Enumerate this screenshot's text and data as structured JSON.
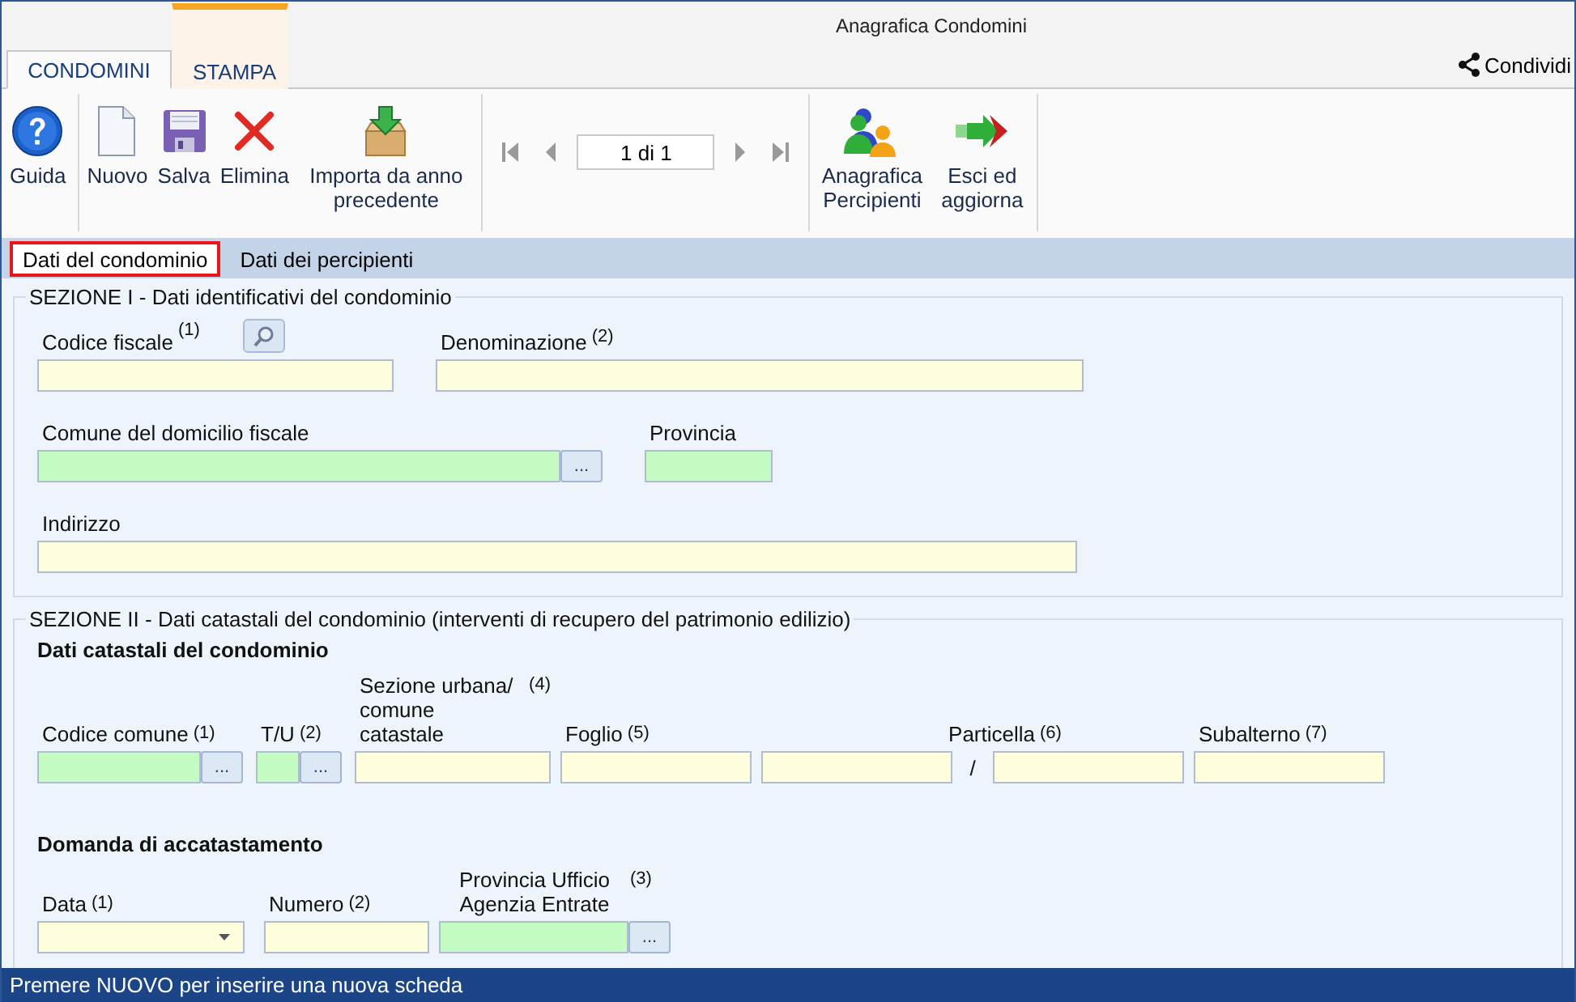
{
  "window": {
    "title": "Anagrafica Condomini"
  },
  "ribbon_tabs": [
    {
      "label": "CONDOMINI",
      "selected": true,
      "highlighted": false
    },
    {
      "label": "STAMPA",
      "selected": false,
      "highlighted": true
    }
  ],
  "share": {
    "label": "Condividi"
  },
  "toolbar": {
    "groups": [
      [
        {
          "label": "Guida"
        }
      ],
      [
        {
          "label": "Nuovo"
        },
        {
          "label": "Salva"
        },
        {
          "label": "Elimina"
        },
        {
          "label": "Importa da anno precedente"
        }
      ],
      [
        {
          "kind": "pager",
          "value": "1 di 1"
        }
      ],
      [
        {
          "label": "Anagrafica Percipienti"
        },
        {
          "label": "Esci ed aggiorna"
        }
      ]
    ]
  },
  "form_tabs": [
    {
      "label": "Dati del condominio",
      "selected": true
    },
    {
      "label": "Dati dei percipienti",
      "selected": false
    }
  ],
  "sections": [
    {
      "title": "SEZIONE I - Dati identificativi del condominio",
      "blocks": [
        {
          "fields": [
            {
              "label": "Codice fiscale",
              "note": "(1)",
              "kind": "search",
              "color": "#ffffdd"
            },
            {
              "label": "Denominazione",
              "note": "(2)",
              "kind": "text",
              "color": "#ffffdd"
            }
          ]
        },
        {
          "fields": [
            {
              "label": "Comune del domicilio fiscale",
              "kind": "lookup",
              "button": "...",
              "color": "#c4fcc4"
            },
            {
              "label": "Provincia",
              "kind": "text",
              "color": "#c4fcc4"
            }
          ]
        },
        {
          "fields": [
            {
              "label": "Indirizzo",
              "kind": "text",
              "color": "#ffffdd"
            }
          ]
        }
      ]
    },
    {
      "title": "SEZIONE II - Dati catastali del condominio (interventi di recupero del patrimonio edilizio)",
      "blocks": [
        {
          "heading": "Dati catastali del condominio",
          "fields": [
            {
              "label": "Codice comune",
              "note": "(1)",
              "kind": "lookup",
              "button": "...",
              "color": "#c4fcc4"
            },
            {
              "label": "T/U",
              "note": "(2)",
              "kind": "lookup",
              "button": "...",
              "color": "#c4fcc4"
            },
            {
              "label": "Sezione urbana/ comune catastale",
              "note": "(4)",
              "kind": "text",
              "color": "#ffffdd"
            },
            {
              "label": "Foglio",
              "note": "(5)",
              "kind": "text",
              "color": "#ffffdd"
            },
            {
              "label": "Particella",
              "note": "(6)",
              "kind": "split",
              "separator": "/",
              "color": "#ffffdd"
            },
            {
              "label": "Subalterno",
              "note": "(7)",
              "kind": "text",
              "color": "#ffffdd"
            }
          ]
        },
        {
          "heading": "Domanda di accatastamento",
          "fields": [
            {
              "label": "Data",
              "note": "(1)",
              "kind": "date",
              "color": "#ffffdd"
            },
            {
              "label": "Numero",
              "note": "(2)",
              "kind": "text",
              "color": "#ffffdd"
            },
            {
              "label": "Provincia Ufficio Agenzia Entrate",
              "note": "(3)",
              "kind": "lookup",
              "button": "...",
              "color": "#c4fcc4"
            }
          ]
        }
      ]
    }
  ],
  "status_bar": {
    "text": "Premere NUOVO per inserire una nuova scheda"
  }
}
